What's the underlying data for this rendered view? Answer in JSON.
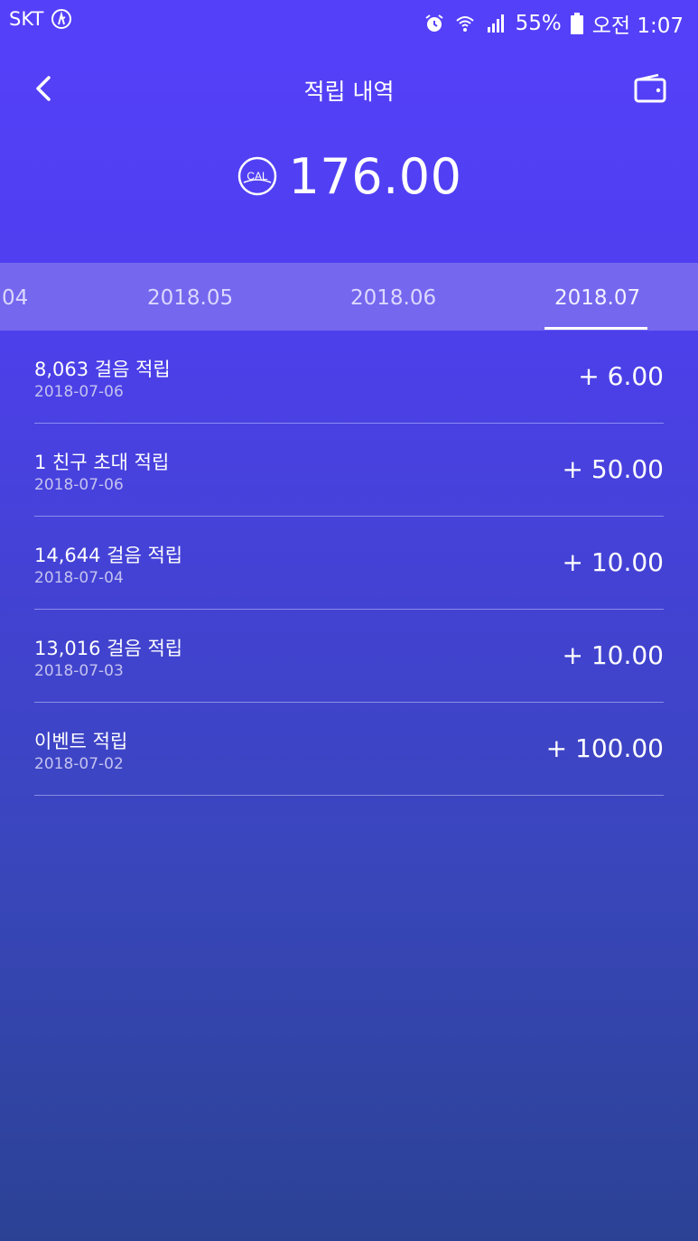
{
  "status": {
    "carrier": "SKT",
    "battery": "55%",
    "time": "오전 1:07"
  },
  "header": {
    "title": "적립 내역"
  },
  "balance": {
    "token_label": "CAL",
    "amount": "176.00"
  },
  "months": [
    {
      "label": "04",
      "active": false
    },
    {
      "label": "2018.05",
      "active": false
    },
    {
      "label": "2018.06",
      "active": false
    },
    {
      "label": "2018.07",
      "active": true
    }
  ],
  "history": [
    {
      "title": "8,063 걸음 적립",
      "date": "2018-07-06",
      "amount": "+ 6.00"
    },
    {
      "title": "1 친구 초대 적립",
      "date": "2018-07-06",
      "amount": "+ 50.00"
    },
    {
      "title": "14,644 걸음 적립",
      "date": "2018-07-04",
      "amount": "+ 10.00"
    },
    {
      "title": "13,016 걸음 적립",
      "date": "2018-07-03",
      "amount": "+ 10.00"
    },
    {
      "title": "이벤트 적립",
      "date": "2018-07-02",
      "amount": "+ 100.00"
    }
  ]
}
